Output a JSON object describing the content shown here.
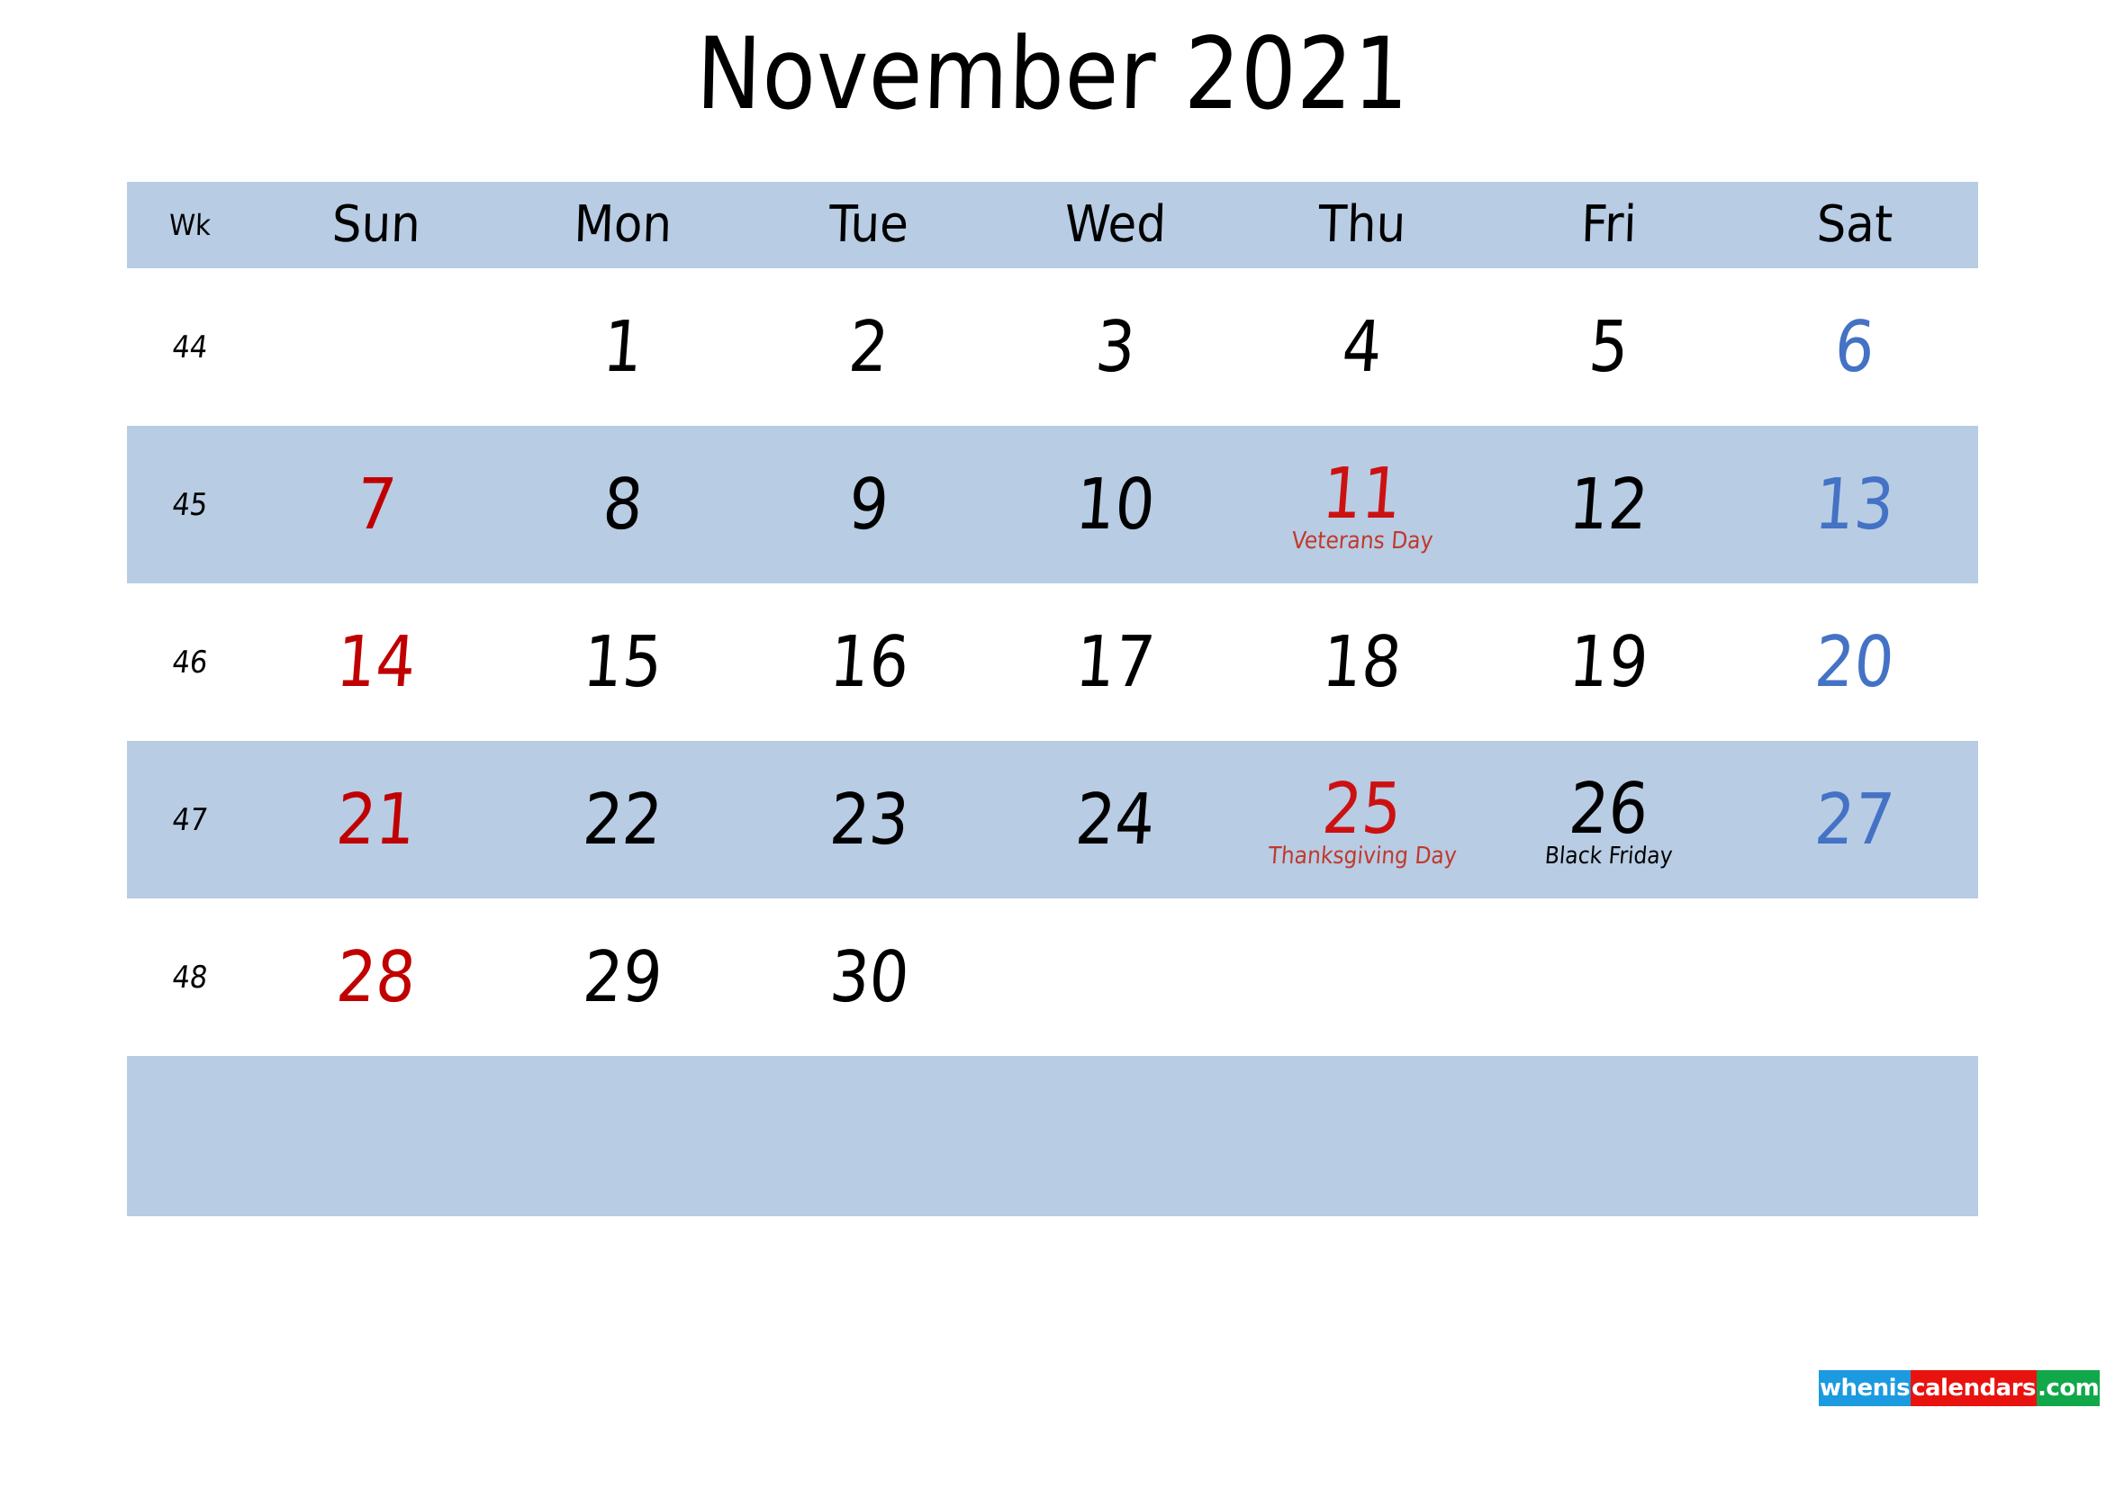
{
  "title": "November 2021",
  "colors": {
    "shade_blue": "#b8cce4",
    "sunday_red": "#c00000",
    "saturday_blue": "#4472c4",
    "holiday_red": "#cc1111",
    "watermark_blue": "#1b9ae0",
    "watermark_red": "#e8130f",
    "watermark_green": "#10a84a"
  },
  "header": {
    "week_label": "Wk",
    "days": [
      "Sun",
      "Mon",
      "Tue",
      "Wed",
      "Thu",
      "Fri",
      "Sat"
    ]
  },
  "weeks": [
    {
      "week_number": "44",
      "shaded": false,
      "days": [
        {
          "num": "",
          "note": "",
          "style": "sun"
        },
        {
          "num": "1",
          "note": "",
          "style": ""
        },
        {
          "num": "2",
          "note": "",
          "style": ""
        },
        {
          "num": "3",
          "note": "",
          "style": ""
        },
        {
          "num": "4",
          "note": "",
          "style": ""
        },
        {
          "num": "5",
          "note": "",
          "style": ""
        },
        {
          "num": "6",
          "note": "",
          "style": "sat"
        }
      ]
    },
    {
      "week_number": "45",
      "shaded": true,
      "days": [
        {
          "num": "7",
          "note": "",
          "style": "sun"
        },
        {
          "num": "8",
          "note": "",
          "style": ""
        },
        {
          "num": "9",
          "note": "",
          "style": ""
        },
        {
          "num": "10",
          "note": "",
          "style": ""
        },
        {
          "num": "11",
          "note": "Veterans Day",
          "style": "holiday",
          "note_style": "red"
        },
        {
          "num": "12",
          "note": "",
          "style": ""
        },
        {
          "num": "13",
          "note": "",
          "style": "sat"
        }
      ]
    },
    {
      "week_number": "46",
      "shaded": false,
      "days": [
        {
          "num": "14",
          "note": "",
          "style": "sun"
        },
        {
          "num": "15",
          "note": "",
          "style": ""
        },
        {
          "num": "16",
          "note": "",
          "style": ""
        },
        {
          "num": "17",
          "note": "",
          "style": ""
        },
        {
          "num": "18",
          "note": "",
          "style": ""
        },
        {
          "num": "19",
          "note": "",
          "style": ""
        },
        {
          "num": "20",
          "note": "",
          "style": "sat"
        }
      ]
    },
    {
      "week_number": "47",
      "shaded": true,
      "days": [
        {
          "num": "21",
          "note": "",
          "style": "sun"
        },
        {
          "num": "22",
          "note": "",
          "style": ""
        },
        {
          "num": "23",
          "note": "",
          "style": ""
        },
        {
          "num": "24",
          "note": "",
          "style": ""
        },
        {
          "num": "25",
          "note": "Thanksgiving Day",
          "style": "holiday",
          "note_style": "red"
        },
        {
          "num": "26",
          "note": "Black Friday",
          "style": "",
          "note_style": "black"
        },
        {
          "num": "27",
          "note": "",
          "style": "sat"
        }
      ]
    },
    {
      "week_number": "48",
      "shaded": false,
      "days": [
        {
          "num": "28",
          "note": "",
          "style": "sun"
        },
        {
          "num": "29",
          "note": "",
          "style": ""
        },
        {
          "num": "30",
          "note": "",
          "style": ""
        },
        {
          "num": "",
          "note": "",
          "style": ""
        },
        {
          "num": "",
          "note": "",
          "style": ""
        },
        {
          "num": "",
          "note": "",
          "style": ""
        },
        {
          "num": "",
          "note": "",
          "style": "sat"
        }
      ]
    },
    {
      "week_number": "",
      "shaded": true,
      "empty": true,
      "days": [
        {
          "num": "",
          "note": "",
          "style": "sun"
        },
        {
          "num": "",
          "note": "",
          "style": ""
        },
        {
          "num": "",
          "note": "",
          "style": ""
        },
        {
          "num": "",
          "note": "",
          "style": ""
        },
        {
          "num": "",
          "note": "",
          "style": ""
        },
        {
          "num": "",
          "note": "",
          "style": ""
        },
        {
          "num": "",
          "note": "",
          "style": "sat"
        }
      ]
    }
  ],
  "watermark": {
    "segment_1": "whenis",
    "segment_2": "calendars",
    "segment_3": ".com"
  }
}
